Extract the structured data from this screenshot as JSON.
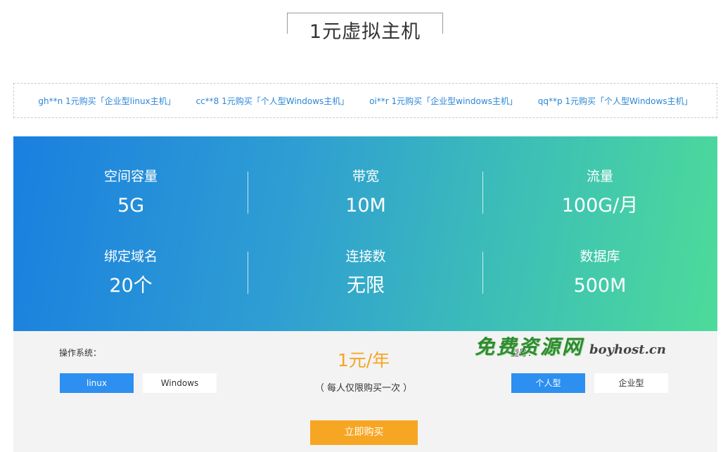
{
  "title": "1元虚拟主机",
  "ticker": [
    "gh**n 1元购买「企业型linux主机」",
    "cc**8 1元购买「个人型Windows主机」",
    "oi**r 1元购买「企业型windows主机」",
    "qq**p 1元购买「个人型Windows主机」"
  ],
  "specs": [
    {
      "label": "空间容量",
      "value": "5G"
    },
    {
      "label": "带宽",
      "value": "10M"
    },
    {
      "label": "流量",
      "value": "100G/月"
    },
    {
      "label": "绑定域名",
      "value": "20个"
    },
    {
      "label": "连接数",
      "value": "无限"
    },
    {
      "label": "数据库",
      "value": "500M"
    }
  ],
  "os": {
    "label": "操作系统：",
    "options": [
      "linux",
      "Windows"
    ],
    "selected": "linux"
  },
  "type": {
    "label": "型号：",
    "options": [
      "个人型",
      "企业型"
    ],
    "selected": "个人型"
  },
  "price": "1元/年",
  "note": "（ 每人仅限购买一次 ）",
  "buy_label": "立即购买",
  "watermark": {
    "cn": "免费资源网",
    "en": "boyhost.cn"
  },
  "colors": {
    "accent_blue": "#2d8ff0",
    "price_orange": "#f5a623",
    "link_blue": "#2a86d8",
    "gradient_start": "#1a7fe0",
    "gradient_end": "#4ddb99"
  }
}
